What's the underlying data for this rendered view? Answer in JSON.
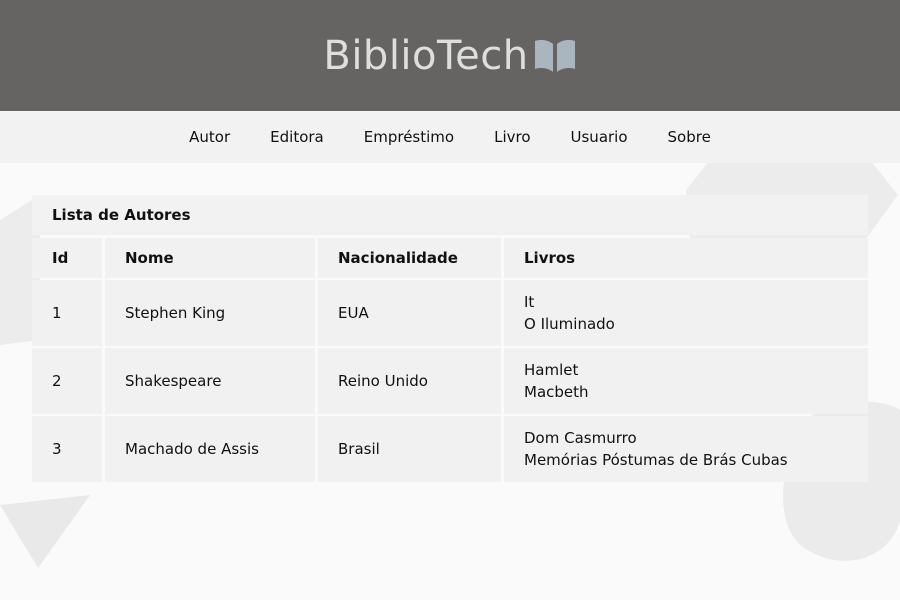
{
  "brand": {
    "name": "BiblioTech",
    "icon": "open-book-icon"
  },
  "nav": {
    "items": [
      {
        "label": "Autor"
      },
      {
        "label": "Editora"
      },
      {
        "label": "Empréstimo"
      },
      {
        "label": "Livro"
      },
      {
        "label": "Usuario"
      },
      {
        "label": "Sobre"
      }
    ]
  },
  "authors_table": {
    "title": "Lista de Autores",
    "headers": [
      "Id",
      "Nome",
      "Nacionalidade",
      "Livros"
    ],
    "rows": [
      {
        "id": "1",
        "nome": "Stephen King",
        "nacionalidade": "EUA",
        "livros": [
          "It",
          "O Iluminado"
        ]
      },
      {
        "id": "2",
        "nome": "Shakespeare",
        "nacionalidade": "Reino Unido",
        "livros": [
          "Hamlet",
          "Macbeth"
        ]
      },
      {
        "id": "3",
        "nome": "Machado de Assis",
        "nacionalidade": "Brasil",
        "livros": [
          "Dom Casmurro",
          "Memórias Póstumas de Brás Cubas"
        ]
      }
    ]
  },
  "colors": {
    "header_bg": "#666462",
    "nav_bg": "#f2f2f2",
    "page_bg": "#fafafa",
    "cell_bg": "#f1f1f1",
    "logo_text": "#dedede",
    "logo_icon": "#a9b6bf"
  }
}
